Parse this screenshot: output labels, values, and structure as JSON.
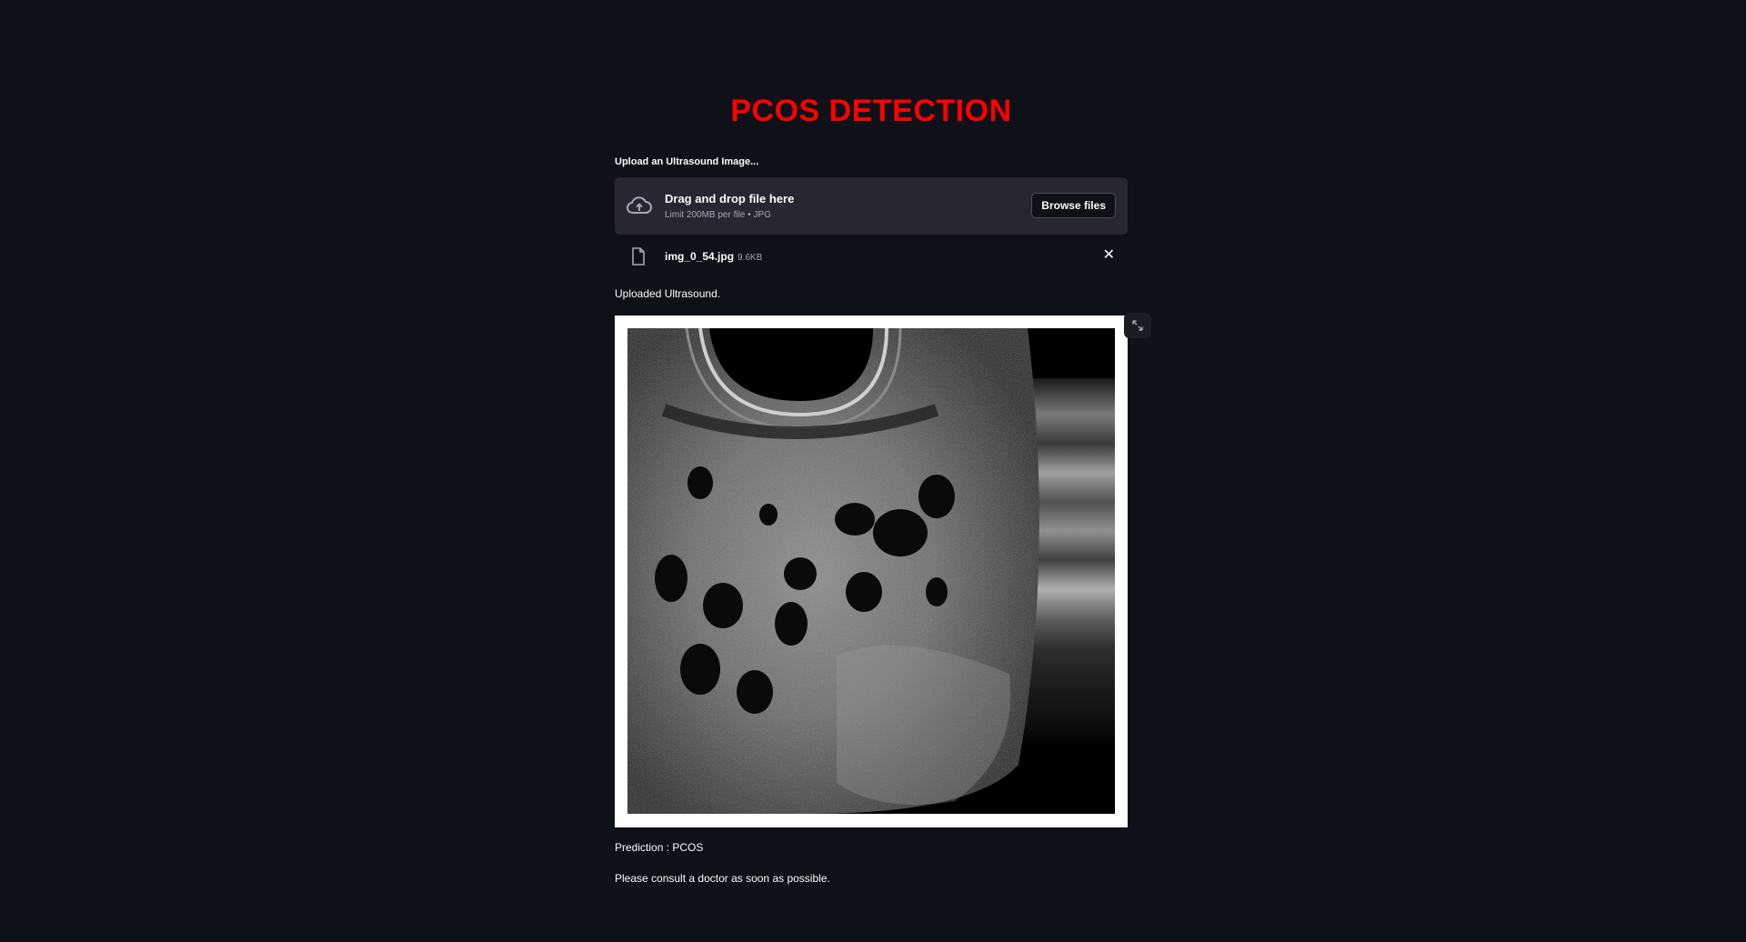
{
  "app": {
    "title": "PCOS DETECTION",
    "title_color": "#ff0000",
    "background_color": "#0e1117"
  },
  "uploader": {
    "label": "Upload an Ultrasound Image...",
    "dropzone_title": "Drag and drop file here",
    "dropzone_limit": "Limit 200MB per file • JPG",
    "browse_label": "Browse files",
    "icon": "cloud-upload-icon"
  },
  "uploaded_file": {
    "name": "img_0_54.jpg",
    "size": "9.6KB",
    "icon": "file-icon",
    "remove_icon": "close-icon"
  },
  "image": {
    "caption": "Uploaded Ultrasound.",
    "expand_icon": "fullscreen-icon"
  },
  "result": {
    "prediction": "Prediction : PCOS",
    "advice": "Please consult a doctor as soon as possible."
  }
}
